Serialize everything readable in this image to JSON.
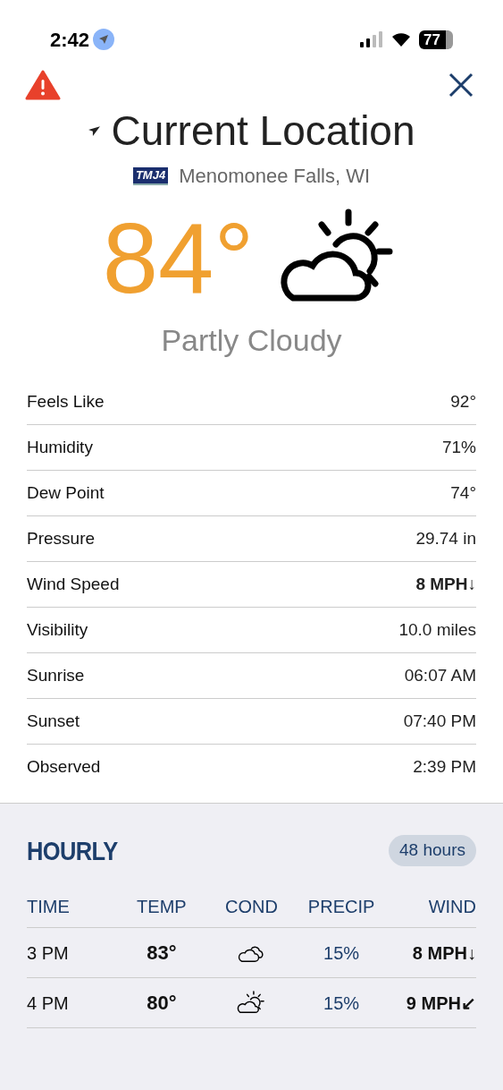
{
  "status_bar": {
    "time": "2:42",
    "battery": "77"
  },
  "header": {
    "title": "Current Location",
    "logo": "TMJ4",
    "location": "Menomonee Falls, WI"
  },
  "current": {
    "temperature": "84°",
    "condition": "Partly Cloudy"
  },
  "details": [
    {
      "label": "Feels Like",
      "value": "92°",
      "bold": false
    },
    {
      "label": "Humidity",
      "value": "71%",
      "bold": false
    },
    {
      "label": "Dew Point",
      "value": "74°",
      "bold": false
    },
    {
      "label": "Pressure",
      "value": "29.74 in",
      "bold": false
    },
    {
      "label": "Wind Speed",
      "value": "8 MPH↓",
      "bold": true
    },
    {
      "label": "Visibility",
      "value": "10.0 miles",
      "bold": false
    },
    {
      "label": "Sunrise",
      "value": "06:07 AM",
      "bold": false
    },
    {
      "label": "Sunset",
      "value": "07:40 PM",
      "bold": false
    },
    {
      "label": "Observed",
      "value": "2:39 PM",
      "bold": false
    }
  ],
  "hourly": {
    "title": "HOURLY",
    "range_button": "48 hours",
    "columns": [
      "TIME",
      "TEMP",
      "COND",
      "PRECIP",
      "WIND"
    ],
    "rows": [
      {
        "time": "3 PM",
        "temp": "83°",
        "kind": "cloudy",
        "precip": "15%",
        "wind": "8 MPH↓"
      },
      {
        "time": "4 PM",
        "temp": "80°",
        "kind": "partly-cloudy",
        "precip": "15%",
        "wind": "9 MPH↙"
      }
    ]
  }
}
